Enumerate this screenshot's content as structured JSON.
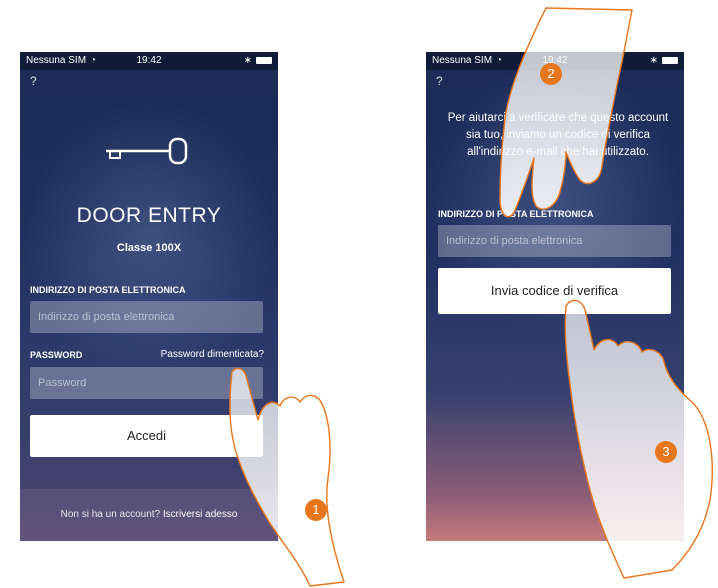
{
  "left_screen": {
    "status": {
      "carrier": "Nessuna SIM",
      "time": "19:42"
    },
    "help": "?",
    "app_title": "DOOR ENTRY",
    "app_subtitle": "Classe 100X",
    "email_label": "INDIRIZZO DI POSTA ELETTRONICA",
    "email_placeholder": "Indirizzo di posta elettronica",
    "password_label": "PASSWORD",
    "forgot_link": "Password dimenticata?",
    "password_placeholder": "Password",
    "login_button": "Accedi",
    "footer_text": "Non si ha un account?",
    "footer_link": "Iscriversi adesso"
  },
  "right_screen": {
    "status": {
      "carrier": "Nessuna SIM",
      "time": "19:42"
    },
    "help": "?",
    "info_text": "Per aiutarci a verificare che questo account sia tuo, inviamo un codice di verifica all'indirizzo e-mail che hai utilizzato.",
    "email_label": "INDIRIZZO DI POSTA ELETTRONICA",
    "email_placeholder": "Indirizzo di posta elettronica",
    "send_button": "Invia codice di verifica"
  },
  "step_badges": [
    "1",
    "2",
    "3"
  ],
  "colors": {
    "badge": "#e8761c",
    "hand_outline": "#e8761c"
  }
}
